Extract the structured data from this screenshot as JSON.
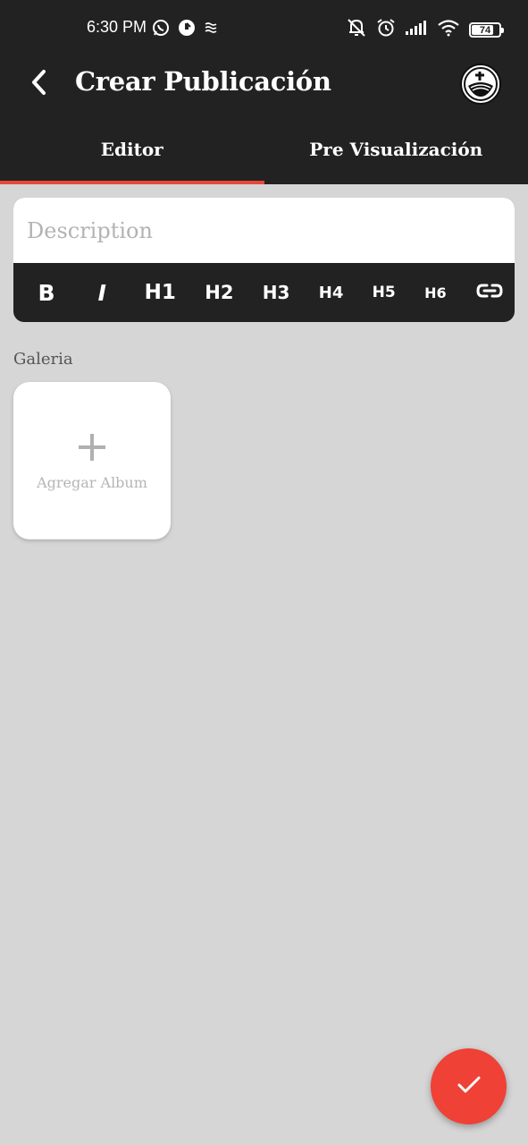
{
  "status_bar": {
    "time": "6:30 PM",
    "left_icons": [
      "whatsapp-icon",
      "app-notification-icon",
      "sync-icon"
    ],
    "right_icons": [
      "mute-icon",
      "alarm-icon",
      "signal-icon",
      "wifi-icon"
    ],
    "battery_level": "74"
  },
  "app_bar": {
    "title": "Crear Publicación",
    "back_icon": "back-arrow-icon",
    "logo_icon": "church-logo-icon"
  },
  "tabs": [
    {
      "label": "Editor",
      "selected": true
    },
    {
      "label": "Pre Visualización",
      "selected": false
    }
  ],
  "editor": {
    "description_placeholder": "Description",
    "description_value": "",
    "toolbar": {
      "bold": "B",
      "italic": "I",
      "h1": "H1",
      "h2": "H2",
      "h3": "H3",
      "h4": "H4",
      "h5": "H5",
      "h6": "H6",
      "link_icon": "link-icon"
    }
  },
  "gallery": {
    "label": "Galeria",
    "add_album_label": "Agregar Album"
  },
  "fab": {
    "icon": "check-icon"
  },
  "colors": {
    "app_bar": "#222222",
    "background": "#d6d6d6",
    "accent": "#e8473c",
    "fab": "#ef4136"
  }
}
